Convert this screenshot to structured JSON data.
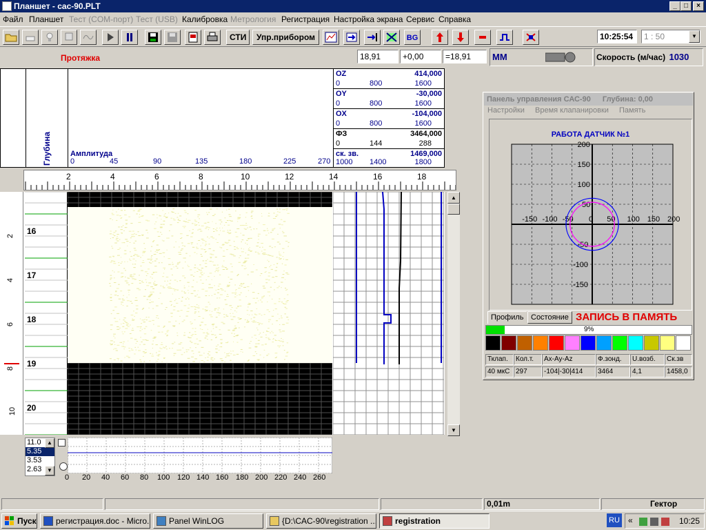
{
  "window": {
    "title": "Планшет - cac-90.PLT",
    "min": "_",
    "max": "□",
    "close": "×"
  },
  "menu": [
    {
      "label": "Файл",
      "enabled": true
    },
    {
      "label": "Планшет",
      "enabled": true
    },
    {
      "label": "Тест (COM-порт)",
      "enabled": false
    },
    {
      "label": "Тест (USB)",
      "enabled": false
    },
    {
      "label": "Калибровка",
      "enabled": true
    },
    {
      "label": "Метрология",
      "enabled": false
    },
    {
      "label": "Регистрация",
      "enabled": true
    },
    {
      "label": "Настройка экрана",
      "enabled": true
    },
    {
      "label": "Сервис",
      "enabled": true
    },
    {
      "label": "Справка",
      "enabled": true
    }
  ],
  "toolbar": {
    "sti_label": "СТИ",
    "control_label": "Упр.прибором",
    "clock": "10:25:54",
    "scale_value": "1 : 50"
  },
  "info": {
    "mode": "Протяжка",
    "val1": "18,91",
    "val2": "+0,00",
    "val3": "=18,91",
    "unit": "ММ",
    "speed_label": "Скорость (м/час)",
    "speed_value": "1030"
  },
  "header": {
    "depth_label": "Глубина",
    "amp_label": "Амплитуда",
    "amp_ticks": [
      "0",
      "45",
      "90",
      "135",
      "180",
      "225",
      "270"
    ],
    "channels": [
      {
        "name": "OZ",
        "value": "414,000",
        "a": "0",
        "b": "800",
        "c": "1600"
      },
      {
        "name": "OY",
        "value": "-30,000",
        "a": "0",
        "b": "800",
        "c": "1600"
      },
      {
        "name": "OX",
        "value": "-104,000",
        "a": "0",
        "b": "800",
        "c": "1600"
      },
      {
        "name": "ФЗ",
        "value": "3464,000",
        "a": "0",
        "b": "144",
        "c": "288"
      },
      {
        "name": "ск. зв.",
        "value": "1469,000",
        "a": "1000",
        "b": "1400",
        "c": "1800"
      }
    ]
  },
  "ruler": {
    "labels": [
      "2",
      "4",
      "6",
      "8",
      "10",
      "12",
      "14",
      "16",
      "18"
    ]
  },
  "depths": [
    "16",
    "17",
    "18",
    "19",
    "20"
  ],
  "left_scale": [
    "2",
    "4",
    "6",
    "8",
    "10"
  ],
  "control_panel": {
    "title": "Панель управления САС-90",
    "depth": "Глубина: 0,00",
    "menu": [
      "Настройки",
      "Время клапанировки",
      "Память"
    ],
    "graph_title": "РАБОТА ДАТЧИК №1",
    "tabs": [
      "Профиль",
      "Состояние"
    ],
    "record_label": "ЗАПИСЬ В ПАМЯТЬ",
    "progress": "9%",
    "progress_value": 0.09,
    "palette": [
      "#000000",
      "#800000",
      "#c06000",
      "#ff8000",
      "#ff0000",
      "#ff80ff",
      "#0000ff",
      "#00a0ff",
      "#00ff00",
      "#00ffff",
      "#c8c800",
      "#ffff80",
      "#ffffff"
    ],
    "table_headers": [
      "Тклап.",
      "Кол.т.",
      "Ax-Ay-Az",
      "Ф.зонд.",
      "U.возб.",
      "Ск.зв"
    ],
    "table_values": [
      "40 мкС",
      "297",
      "-104|-30|414",
      "3464",
      "4,1",
      "1458,0"
    ]
  },
  "chart_data": {
    "type": "scatter",
    "title": "РАБОТА ДАТЧИК №1",
    "x_ticks": [
      "-150",
      "-100",
      "-50",
      "0",
      "50",
      "100",
      "150",
      "200"
    ],
    "y_ticks": [
      "200",
      "150",
      "100",
      "50",
      "0",
      "-50",
      "-100",
      "-150"
    ],
    "xlim": [
      -200,
      200
    ],
    "ylim": [
      -200,
      200
    ],
    "grid": true,
    "series": [
      {
        "shape": "circle",
        "color": "#0000ff",
        "center": [
          0,
          0
        ],
        "radius": 65
      },
      {
        "shape": "circle",
        "color": "#ff00ff",
        "center": [
          0,
          0
        ],
        "radius": 55
      }
    ]
  },
  "mini": {
    "list": [
      "11.0",
      "5.35",
      "3.53",
      "2.63"
    ],
    "ticks": [
      "0",
      "20",
      "40",
      "60",
      "80",
      "100",
      "120",
      "140",
      "160",
      "180",
      "200",
      "220",
      "240",
      "260"
    ]
  },
  "statusbar": {
    "step": "0,01m",
    "type": "Гектор"
  },
  "taskbar": {
    "start": "Пуск",
    "tasks": [
      "регистрация.doc - Micro...",
      "Panel WinLOG",
      "{D:\\CAC-90\\registration ...",
      "registration"
    ],
    "lang": "RU",
    "time": "10:25"
  }
}
